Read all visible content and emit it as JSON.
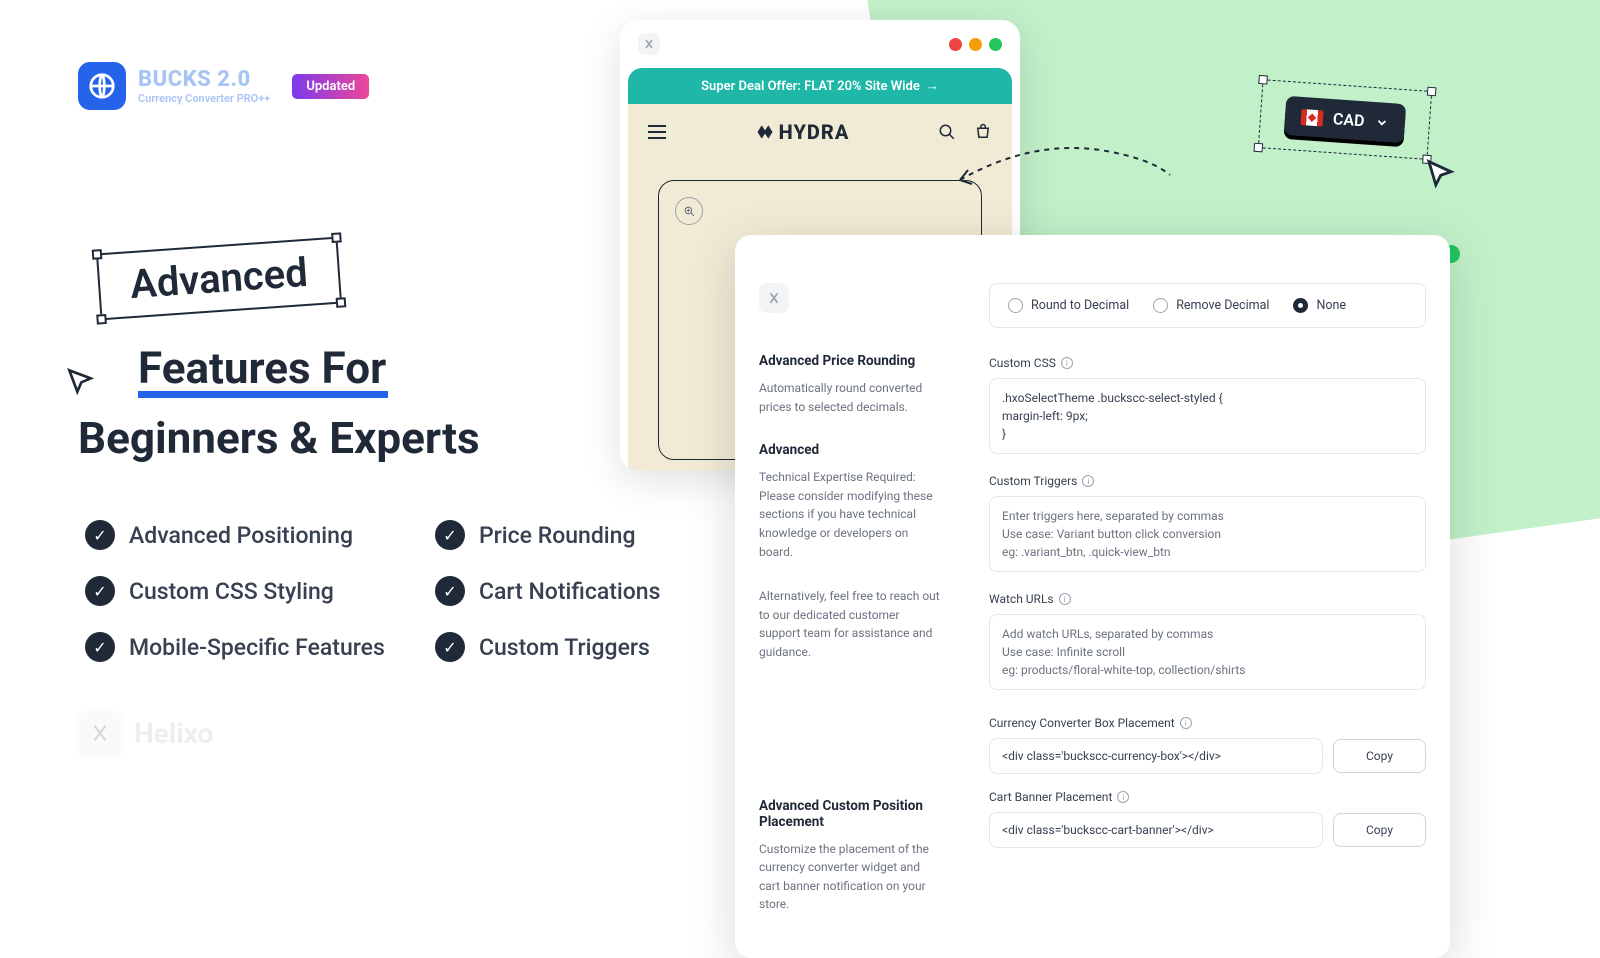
{
  "brand": {
    "title": "BUCKS 2.0",
    "subtitle": "Currency Converter PRO++",
    "badge": "Updated"
  },
  "hero": {
    "word1": "Advanced",
    "line2": "Features For",
    "line3": "Beginners & Experts"
  },
  "features": [
    "Advanced Positioning",
    "Price Rounding",
    "Custom CSS Styling",
    "Cart Notifications",
    "Mobile-Specific Features",
    "Custom Triggers"
  ],
  "helixo": "Helixo",
  "hydra": {
    "promo": "Super Deal Offer: FLAT 20% Site Wide",
    "brand": "HYDRA"
  },
  "cad": {
    "label": "CAD"
  },
  "panel": {
    "rounding": {
      "heading": "Advanced Price Rounding",
      "desc": "Automatically round converted prices to selected decimals."
    },
    "advanced": {
      "heading": "Advanced",
      "desc1": "Technical Expertise Required: Please consider modifying these sections if you have technical knowledge or developers on board.",
      "desc2": "Alternatively, feel free to reach out to our dedicated customer support team for assistance and guidance."
    },
    "placement": {
      "heading": "Advanced Custom Position Placement",
      "desc": "Customize the placement of the currency converter widget and cart banner notification on your store."
    },
    "radios": {
      "opt1": "Round to Decimal",
      "opt2": "Remove Decimal",
      "opt3": "None"
    },
    "css": {
      "label": "Custom CSS",
      "value": ".hxoSelectTheme .buckscc-select-styled {\n      margin-left: 9px;\n}"
    },
    "triggers": {
      "label": "Custom Triggers",
      "placeholder": "Enter triggers here, separated by commas\nUse case: Variant button click conversion\neg: .variant_btn, .quick-view_btn"
    },
    "watch": {
      "label": "Watch URLs",
      "placeholder": "Add watch URLs, separated by commas\nUse case: Infinite scroll\neg: products/floral-white-top, collection/shirts"
    },
    "box_placement": {
      "label": "Currency Converter Box Placement",
      "code": "<div class='buckscc-currency-box'></div>",
      "copy": "Copy"
    },
    "banner_placement": {
      "label": "Cart Banner Placement",
      "code": "<div class='buckscc-cart-banner'></div>",
      "copy": "Copy"
    }
  }
}
